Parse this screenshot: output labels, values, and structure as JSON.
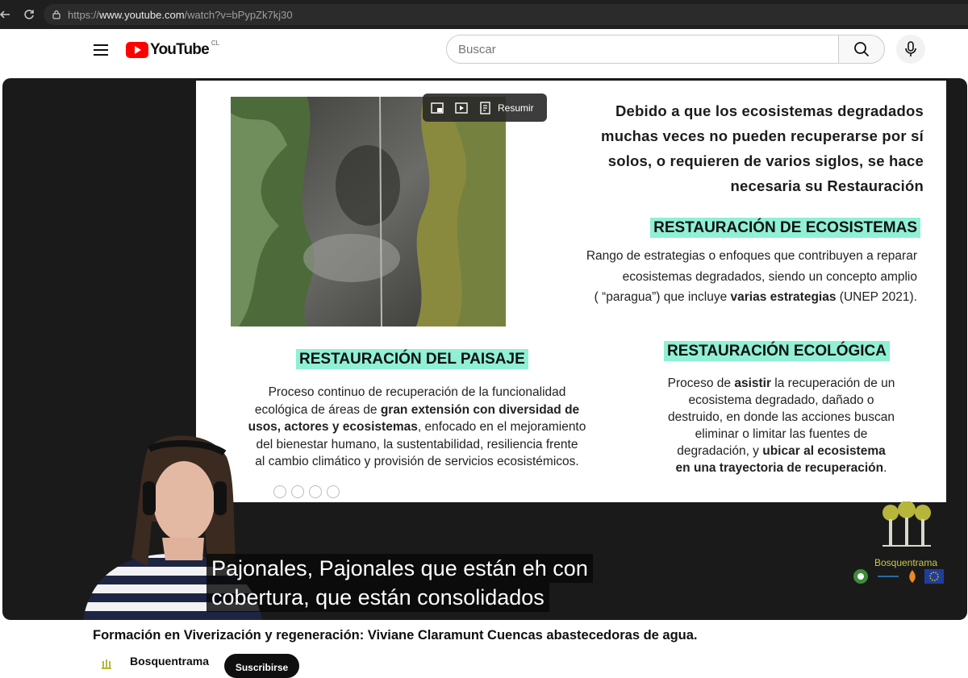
{
  "browser": {
    "url_prefix": "https://",
    "url_domain": "www.youtube.com",
    "url_path": "/watch?v=bPypZk7kj30"
  },
  "header": {
    "logo_text": "YouTube",
    "country_code": "CL",
    "search_placeholder": "Buscar"
  },
  "player": {
    "controls": {
      "summary_label": "Resumir"
    },
    "slide": {
      "intro_lines": [
        "Debido a que los ecosistemas degradados",
        "muchas veces no pueden recuperarse por sí",
        "solos, o requieren de varios siglos, se hace",
        "necesaria su Restauración"
      ],
      "eco_heading": "RESTAURACIÓN DE ECOSISTEMAS",
      "eco_text_1": "Rango de estrategias o enfoques que contribuyen a reparar",
      "eco_text_2": "ecosistemas degradados, siendo un concepto amplio",
      "eco_text_3a": "( “paragua”) que incluye ",
      "eco_text_3b": "varias estrategias",
      "eco_text_3c": " (UNEP 2021).",
      "paisaje_heading": "RESTAURACIÓN  DEL PAISAJE",
      "paisaje_1": "Proceso continuo de recuperación de la funcionalidad",
      "paisaje_2a": "ecológica de áreas de ",
      "paisaje_2b": "gran extensión con diversidad de",
      "paisaje_3a": "usos, actores y ecosistemas",
      "paisaje_3b": ", enfocado en el mejoramiento",
      "paisaje_4": "del bienestar humano, la sustentabilidad, resiliencia frente",
      "paisaje_5": "al cambio climático y provisión de servicios ecosistémicos.",
      "ecologica_heading": "RESTAURACIÓN  ECOLÓGICA",
      "ecologica_1a": "Proceso de ",
      "ecologica_1b": "asistir",
      "ecologica_1c": " la recuperación de un",
      "ecologica_2": "ecosistema degradado, dañado o",
      "ecologica_3": "destruido, en donde las acciones buscan",
      "ecologica_4": "eliminar o limitar las fuentes de",
      "ecologica_5a": "degradación, y ",
      "ecologica_5b": "ubicar al ecosistema",
      "ecologica_6": "en una trayectoria de recuperación",
      "ecologica_6_end": "."
    },
    "captions": [
      "Pajonales, Pajonales que están eh con",
      "cobertura, que están consolidados"
    ],
    "brand_name": "Bosquentrama"
  },
  "video": {
    "title": "Formación en Viverización y regeneración: Viviane Claramunt Cuencas abastecedoras de agua.",
    "channel_name": "Bosquentrama",
    "subscribe_label": "Suscribirse"
  },
  "colors": {
    "highlight": "#8ff0d4",
    "youtube_red": "#ff0000",
    "brand_olive": "#c9c84a"
  }
}
